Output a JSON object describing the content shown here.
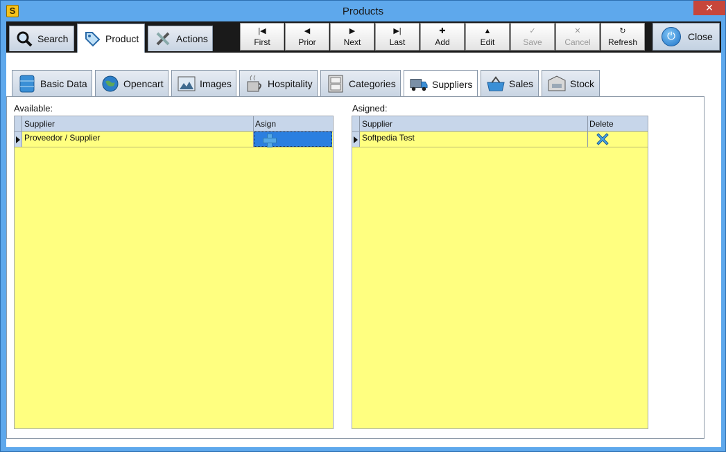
{
  "window": {
    "title": "Products",
    "app_icon_letter": "S",
    "close_glyph": "✕"
  },
  "main_tabs": [
    {
      "label": "Search",
      "icon": "magnifier-icon"
    },
    {
      "label": "Product",
      "icon": "tag-icon"
    },
    {
      "label": "Actions",
      "icon": "tools-icon"
    }
  ],
  "nav_buttons": [
    {
      "label": "First",
      "glyph": "|◀"
    },
    {
      "label": "Prior",
      "glyph": "◀"
    },
    {
      "label": "Next",
      "glyph": "▶"
    },
    {
      "label": "Last",
      "glyph": "▶|"
    },
    {
      "label": "Add",
      "glyph": "✚"
    },
    {
      "label": "Edit",
      "glyph": "▲"
    },
    {
      "label": "Save",
      "glyph": "✓"
    },
    {
      "label": "Cancel",
      "glyph": "✕"
    },
    {
      "label": "Refresh",
      "glyph": "↻"
    }
  ],
  "close_button": {
    "label": "Close",
    "glyph": "⏻"
  },
  "sub_tabs": [
    {
      "label": "Basic Data",
      "icon": "database-icon",
      "glyph": "▤"
    },
    {
      "label": "Opencart",
      "icon": "globe-icon",
      "glyph": "●"
    },
    {
      "label": "Images",
      "icon": "picture-icon",
      "glyph": "▣"
    },
    {
      "label": "Hospitality",
      "icon": "cup-icon",
      "glyph": "☕"
    },
    {
      "label": "Categories",
      "icon": "cabinet-icon",
      "glyph": "▦"
    },
    {
      "label": "Suppliers",
      "icon": "truck-icon",
      "glyph": "⛟"
    },
    {
      "label": "Sales",
      "icon": "basket-icon",
      "glyph": "⊔"
    },
    {
      "label": "Stock",
      "icon": "box-icon",
      "glyph": "▭"
    }
  ],
  "available": {
    "label": "Available:",
    "columns": [
      "Supplier",
      "Asign"
    ],
    "rows": [
      {
        "supplier": "Proveedor / Supplier"
      }
    ]
  },
  "asigned": {
    "label": "Asigned:",
    "columns": [
      "Supplier",
      "Delete"
    ],
    "rows": [
      {
        "supplier": "Softpedia Test"
      }
    ]
  },
  "colors": {
    "grid_bg": "#ffff80",
    "header_bg": "#c7d6ea",
    "selected_cell": "#2b7fe0",
    "titlebar": "#5ea8ec"
  }
}
